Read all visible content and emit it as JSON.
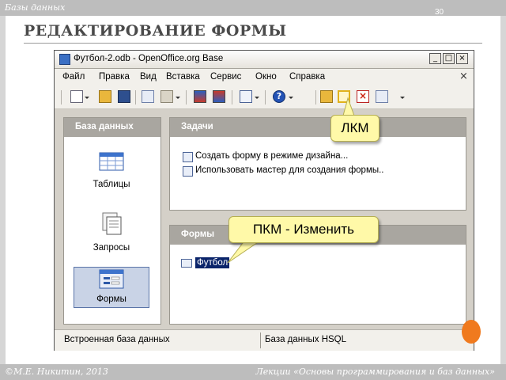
{
  "slide": {
    "section": "Базы данных",
    "number": "30",
    "title": "РЕДАКТИРОВАНИЕ ФОРМЫ",
    "footer_left": "©М.Е. Никитин, 2013",
    "footer_right": "Лекции «Основы программирования и баз данных»"
  },
  "window": {
    "title": "Футбол-2.odb - OpenOffice.org Base",
    "controls": {
      "minimize": "_",
      "maximize": "□",
      "close": "×"
    },
    "menu": [
      "Файл",
      "Правка",
      "Вид",
      "Вставка",
      "Сервис",
      "Окно",
      "Справка"
    ],
    "menu_close": "×"
  },
  "toolbar": {
    "icons": [
      "new-icon",
      "open-folder-icon",
      "save-icon",
      "copy-icon",
      "paste-icon",
      "sort-ascending-icon",
      "sort-descending-icon",
      "form-icon",
      "help-icon",
      "open-object-icon",
      "edit-icon",
      "delete-icon",
      "rename-icon"
    ]
  },
  "left_pane": {
    "header": "База данных",
    "items": [
      {
        "label": "Таблицы",
        "icon": "tables-icon",
        "selected": false
      },
      {
        "label": "Запросы",
        "icon": "queries-icon",
        "selected": false
      },
      {
        "label": "Формы",
        "icon": "forms-icon",
        "selected": true
      }
    ]
  },
  "tasks_pane": {
    "header": "Задачи",
    "tasks": [
      "Создать форму в режиме дизайна...",
      "Использовать мастер для создания формы.."
    ]
  },
  "forms_pane": {
    "header": "Формы",
    "forms": [
      "Футбол"
    ]
  },
  "statusbar": {
    "left": "Встроенная база данных",
    "right": "База данных HSQL"
  },
  "callouts": {
    "lkm": "ЛКМ",
    "pkm": "ПКМ - Изменить"
  },
  "colors": {
    "selection": "#0a246a",
    "callout_bg": "#fff9a8",
    "pane_header": "#a9a6a0",
    "accent_orange": "#f07a1e"
  }
}
